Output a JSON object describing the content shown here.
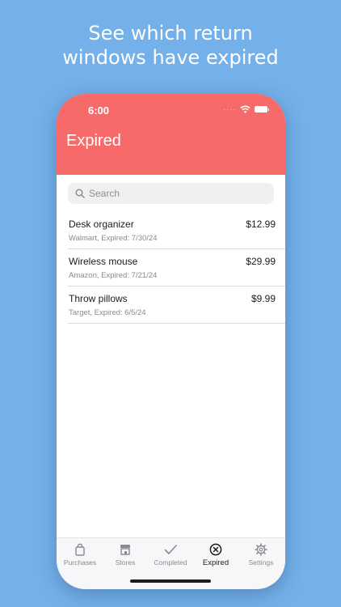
{
  "headline": {
    "line1": "See which return",
    "line2": "windows have expired"
  },
  "status_bar": {
    "time": "6:00"
  },
  "header": {
    "title": "Expired"
  },
  "search": {
    "placeholder": "Search"
  },
  "items": [
    {
      "name": "Desk organizer",
      "subtitle": "Walmart, Expired: 7/30/24",
      "price": "$12.99"
    },
    {
      "name": "Wireless mouse",
      "subtitle": "Amazon, Expired: 7/21/24",
      "price": "$29.99"
    },
    {
      "name": "Throw pillows",
      "subtitle": "Target, Expired: 6/5/24",
      "price": "$9.99"
    }
  ],
  "tabs": [
    {
      "label": "Purchases",
      "icon": "shopping-bag-icon",
      "active": false
    },
    {
      "label": "Stores",
      "icon": "storefront-icon",
      "active": false
    },
    {
      "label": "Completed",
      "icon": "checkmark-icon",
      "active": false
    },
    {
      "label": "Expired",
      "icon": "x-circle-icon",
      "active": true
    },
    {
      "label": "Settings",
      "icon": "gear-icon",
      "active": false
    }
  ],
  "colors": {
    "background": "#74b0e9",
    "header": "#f76a6a",
    "active_tab": "#1c1c1e",
    "inactive_tab": "#8a8a8e"
  }
}
